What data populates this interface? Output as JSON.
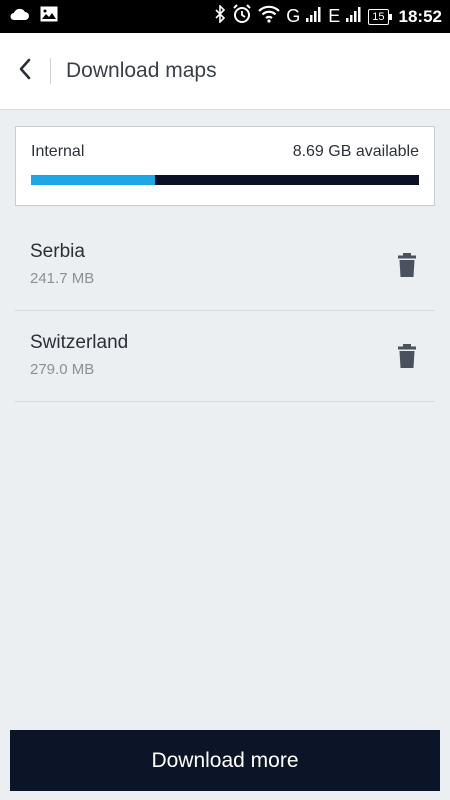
{
  "status_bar": {
    "network_left": "G",
    "network_right": "E",
    "battery": "15",
    "time": "18:52"
  },
  "header": {
    "title": "Download maps"
  },
  "storage": {
    "label": "Internal",
    "available": "8.69 GB available",
    "used_fraction": 0.32,
    "colors": {
      "used": "#1ea7e4",
      "remaining": "#0a1126"
    }
  },
  "maps": [
    {
      "name": "Serbia",
      "size": "241.7 MB"
    },
    {
      "name": "Switzerland",
      "size": "279.0 MB"
    }
  ],
  "footer": {
    "button_label": "Download more"
  }
}
